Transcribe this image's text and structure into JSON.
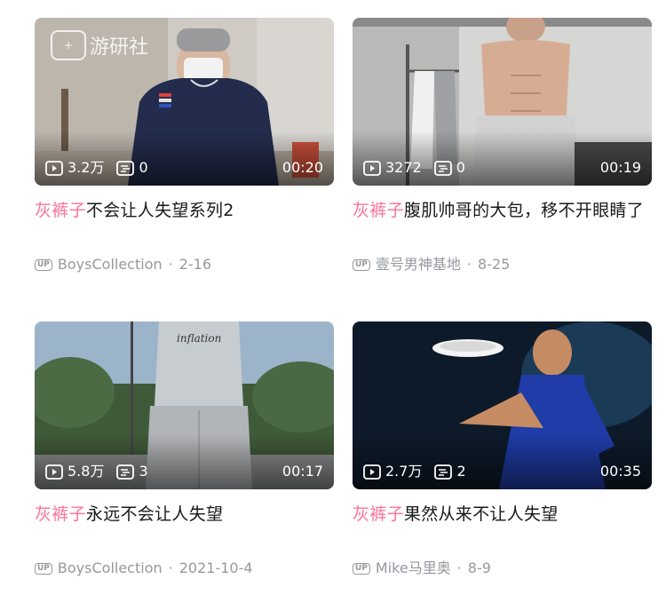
{
  "watermark": {
    "logo_text": "+",
    "text": "游研社"
  },
  "videos": [
    {
      "views": "3.2万",
      "comments": "0",
      "duration": "00:20",
      "title_keyword": "灰裤子",
      "title_rest": "不会让人失望系列2",
      "up_badge": "UP",
      "uploader": "BoysCollection",
      "date": "2-16"
    },
    {
      "views": "3272",
      "comments": "0",
      "duration": "00:19",
      "title_keyword": "灰裤子",
      "title_rest": "腹肌帅哥的大包，移不开眼睛了",
      "up_badge": "UP",
      "uploader": "壹号男神基地",
      "date": "8-25"
    },
    {
      "views": "5.8万",
      "comments": "3",
      "duration": "00:17",
      "title_keyword": "灰裤子",
      "title_rest": "永远不会让人失望",
      "up_badge": "UP",
      "uploader": "BoysCollection",
      "date": "2021-10-4",
      "shirt_text": "inflation"
    },
    {
      "views": "2.7万",
      "comments": "2",
      "duration": "00:35",
      "title_keyword": "灰裤子",
      "title_rest": "果然从来不让人失望",
      "up_badge": "UP",
      "uploader": "Mike马里奥",
      "date": "8-9"
    }
  ],
  "meta_separator": "·",
  "colors": {
    "keyword": "#fb7299",
    "meta": "#9499a0",
    "title": "#18191c"
  },
  "icons": {
    "views": "play-icon",
    "comments": "danmaku-icon",
    "uploader": "up-badge-icon"
  }
}
